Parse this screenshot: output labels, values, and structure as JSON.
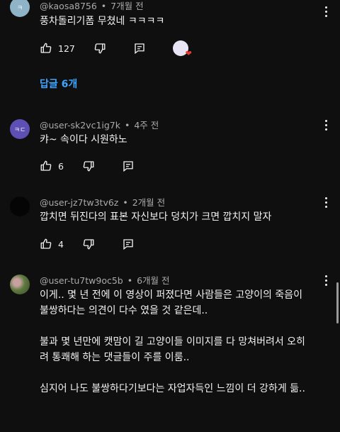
{
  "comments": [
    {
      "avatar_text": "ㅋ",
      "avatar_color": "#8fb3c7",
      "author": "@kaosa8756",
      "time": "7개월 전",
      "text": [
        "풍차돌리기폼 무쳤네 ㅋㅋㅋㅋ"
      ],
      "likes": "127",
      "creator_hearted": true,
      "replies_label": "답글 6개"
    },
    {
      "avatar_text": "ㅋㄷ",
      "avatar_color": "#5d4fb3",
      "author": "@user-sk2vc1ig7k",
      "time": "4주 전",
      "text": [
        "캬~ 속이다 시원하노"
      ],
      "likes": "6"
    },
    {
      "avatar_text": "",
      "avatar_color": "#050505",
      "author": "@user-jz7tw3tv6z",
      "time": "2개월 전",
      "text": [
        "깝치면 뒤진다의 표본 자신보다 덩치가 크면 깝치지 말자"
      ],
      "likes": "4"
    },
    {
      "avatar_text": "",
      "avatar_color": "#6f7a4e",
      "author": "@user-tu7tw9oc5b",
      "time": "6개월 전",
      "text": [
        "이게.. 몇 년 전에 이 영상이 퍼졌다면 사람들은 고양이의 죽음이 불쌍하다는 의견이 다수 였을 것 같은데..",
        "불과 몇 년만에 캣맘이 길 고양이들 이미지를 다 망쳐버려서 오히려 통쾌해 하는 댓글들이 주를 이룸..",
        "심지어 나도 불쌍하다기보다는 자업자득인 느낌이 더 강하게 듦.."
      ]
    }
  ],
  "separator": "•",
  "colors": {
    "background": "#0f0f0f",
    "text": "#f1f1f1",
    "meta": "#aaaaaa",
    "link": "#3ea6ff"
  }
}
